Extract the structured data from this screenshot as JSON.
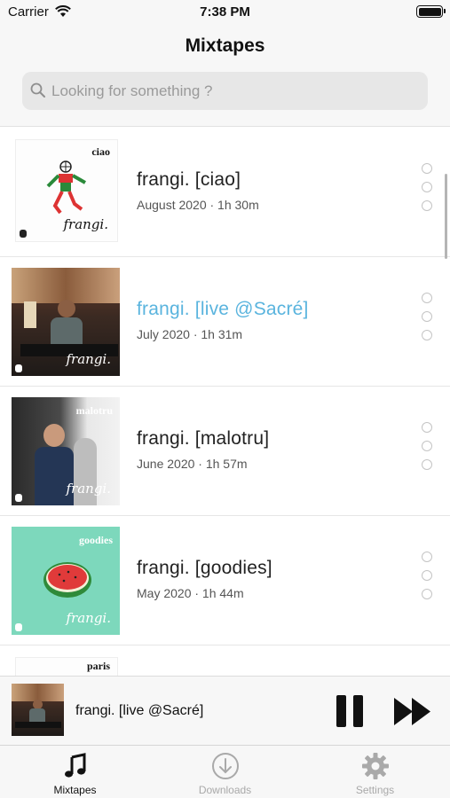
{
  "status_bar": {
    "carrier": "Carrier",
    "time": "7:38 PM"
  },
  "header": {
    "title": "Mixtapes"
  },
  "search": {
    "placeholder": "Looking for something ?"
  },
  "mixtapes": [
    {
      "title": "frangi. [ciao]",
      "subtitle": "August 2020 · 1h 30m",
      "cover_label": "ciao",
      "cover_sign": "frangi.",
      "active": false
    },
    {
      "title": "frangi. [live @Sacré]",
      "subtitle": "July 2020 · 1h 31m",
      "cover_label": "",
      "cover_sign": "frangi.",
      "active": true
    },
    {
      "title": "frangi. [malotru]",
      "subtitle": "June 2020 · 1h 57m",
      "cover_label": "malotru",
      "cover_sign": "frangi.",
      "active": false
    },
    {
      "title": "frangi. [goodies]",
      "subtitle": "May 2020 · 1h 44m",
      "cover_label": "goodies",
      "cover_sign": "frangi.",
      "active": false
    },
    {
      "cover_label": "paris"
    }
  ],
  "now_playing": {
    "title": "frangi. [live @Sacré]"
  },
  "tab_bar": {
    "tabs": [
      {
        "label": "Mixtapes",
        "icon": "music-note-icon",
        "active": true
      },
      {
        "label": "Downloads",
        "icon": "download-icon",
        "active": false
      },
      {
        "label": "Settings",
        "icon": "gear-icon",
        "active": false
      }
    ]
  },
  "colors": {
    "accent": "#5ab4de",
    "text": "#222222",
    "muted": "#a9a9a9"
  }
}
